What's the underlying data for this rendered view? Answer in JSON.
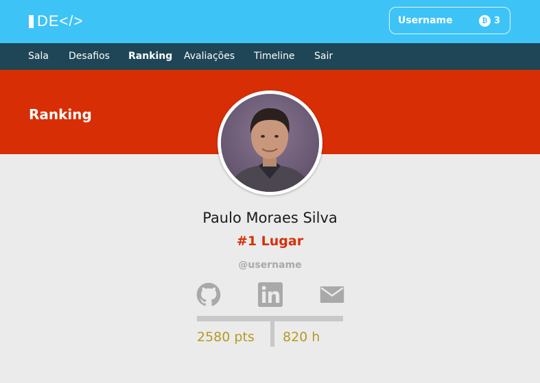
{
  "header": {
    "logo_text": "DE</>",
    "username": "Username",
    "coin_count": "3",
    "brand_color": "#3ec3f7"
  },
  "nav": {
    "items": [
      {
        "label": "Sala",
        "active": false
      },
      {
        "label": "Desafios",
        "active": false
      },
      {
        "label": "Ranking",
        "active": true
      },
      {
        "label": "Avaliações",
        "active": false
      },
      {
        "label": "Timeline",
        "active": false
      },
      {
        "label": "Sair",
        "active": false
      }
    ]
  },
  "banner": {
    "title": "Ranking",
    "color": "#d82e05"
  },
  "profile": {
    "name": "Paulo Moraes Silva",
    "rank": "#1 Lugar",
    "handle": "@username",
    "social_icons": [
      "github-icon",
      "linkedin-icon",
      "mail-icon"
    ],
    "points": "2580 pts",
    "hours": "820 h",
    "stat_color": "#b39a22"
  }
}
